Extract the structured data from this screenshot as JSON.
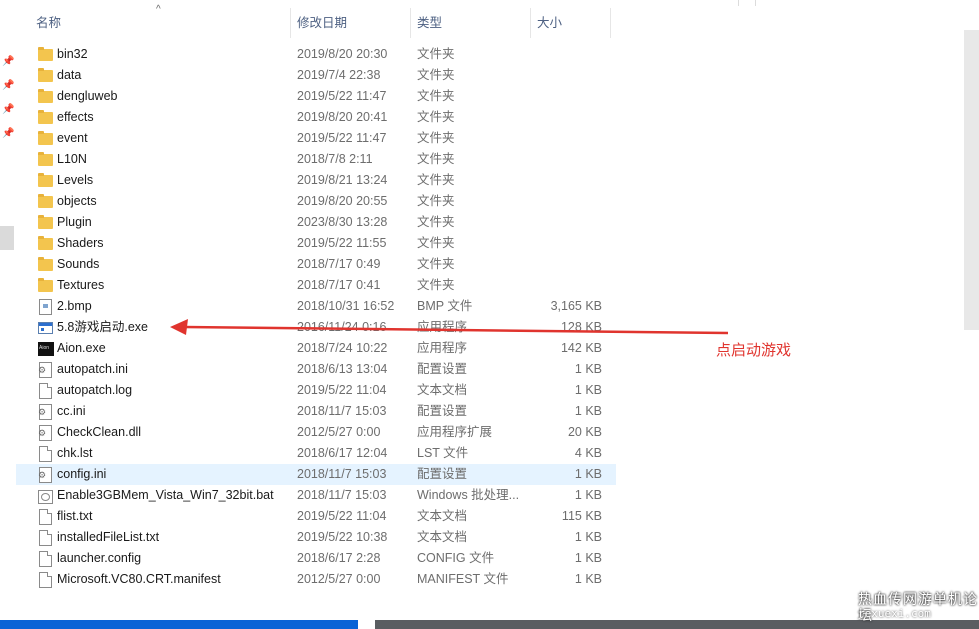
{
  "columns": {
    "name": "名称",
    "date": "修改日期",
    "type": "类型",
    "size": "大小"
  },
  "files": [
    {
      "name": "bin32",
      "date": "2019/8/20 20:30",
      "type": "文件夹",
      "size": "",
      "icon": "folder-icon"
    },
    {
      "name": "data",
      "date": "2019/7/4 22:38",
      "type": "文件夹",
      "size": "",
      "icon": "folder-icon"
    },
    {
      "name": "dengluweb",
      "date": "2019/5/22 11:47",
      "type": "文件夹",
      "size": "",
      "icon": "folder-icon"
    },
    {
      "name": "effects",
      "date": "2019/8/20 20:41",
      "type": "文件夹",
      "size": "",
      "icon": "folder-icon"
    },
    {
      "name": "event",
      "date": "2019/5/22 11:47",
      "type": "文件夹",
      "size": "",
      "icon": "folder-icon"
    },
    {
      "name": "L10N",
      "date": "2018/7/8 2:11",
      "type": "文件夹",
      "size": "",
      "icon": "folder-icon"
    },
    {
      "name": "Levels",
      "date": "2019/8/21 13:24",
      "type": "文件夹",
      "size": "",
      "icon": "folder-icon"
    },
    {
      "name": "objects",
      "date": "2019/8/20 20:55",
      "type": "文件夹",
      "size": "",
      "icon": "folder-icon"
    },
    {
      "name": "Plugin",
      "date": "2023/8/30 13:28",
      "type": "文件夹",
      "size": "",
      "icon": "folder-icon"
    },
    {
      "name": "Shaders",
      "date": "2019/5/22 11:55",
      "type": "文件夹",
      "size": "",
      "icon": "folder-icon"
    },
    {
      "name": "Sounds",
      "date": "2018/7/17 0:49",
      "type": "文件夹",
      "size": "",
      "icon": "folder-icon"
    },
    {
      "name": "Textures",
      "date": "2018/7/17 0:41",
      "type": "文件夹",
      "size": "",
      "icon": "folder-icon"
    },
    {
      "name": "2.bmp",
      "date": "2018/10/31 16:52",
      "type": "BMP 文件",
      "size": "3,165 KB",
      "icon": "bmp-file-icon"
    },
    {
      "name": "5.8游戏启动.exe",
      "date": "2016/11/24 0:16",
      "type": "应用程序",
      "size": "128 KB",
      "icon": "exe-app-icon"
    },
    {
      "name": "Aion.exe",
      "date": "2018/7/24 10:22",
      "type": "应用程序",
      "size": "142 KB",
      "icon": "aion-app-icon"
    },
    {
      "name": "autopatch.ini",
      "date": "2018/6/13 13:04",
      "type": "配置设置",
      "size": "1 KB",
      "icon": "config-file-icon"
    },
    {
      "name": "autopatch.log",
      "date": "2019/5/22 11:04",
      "type": "文本文档",
      "size": "1 KB",
      "icon": "text-file-icon"
    },
    {
      "name": "cc.ini",
      "date": "2018/11/7 15:03",
      "type": "配置设置",
      "size": "1 KB",
      "icon": "config-file-icon"
    },
    {
      "name": "CheckClean.dll",
      "date": "2012/5/27 0:00",
      "type": "应用程序扩展",
      "size": "20 KB",
      "icon": "dll-file-icon"
    },
    {
      "name": "chk.lst",
      "date": "2018/6/17 12:04",
      "type": "LST 文件",
      "size": "4 KB",
      "icon": "text-file-icon"
    },
    {
      "name": "config.ini",
      "date": "2018/11/7 15:03",
      "type": "配置设置",
      "size": "1 KB",
      "icon": "config-file-icon",
      "selected": true
    },
    {
      "name": "Enable3GBMem_Vista_Win7_32bit.bat",
      "date": "2018/11/7 15:03",
      "type": "Windows 批处理...",
      "size": "1 KB",
      "icon": "bat-file-icon"
    },
    {
      "name": "flist.txt",
      "date": "2019/5/22 11:04",
      "type": "文本文档",
      "size": "115 KB",
      "icon": "text-file-icon"
    },
    {
      "name": "installedFileList.txt",
      "date": "2019/5/22 10:38",
      "type": "文本文档",
      "size": "1 KB",
      "icon": "text-file-icon"
    },
    {
      "name": "launcher.config",
      "date": "2018/6/17 2:28",
      "type": "CONFIG 文件",
      "size": "1 KB",
      "icon": "text-file-icon"
    },
    {
      "name": "Microsoft.VC80.CRT.manifest",
      "date": "2012/5/27 0:00",
      "type": "MANIFEST 文件",
      "size": "1 KB",
      "icon": "text-file-icon"
    }
  ],
  "annotation": {
    "text": "点启动游戏",
    "color": "#e0342e"
  },
  "watermark": {
    "text": "热血传网游单机论坛",
    "sub": "rexuexi.com"
  }
}
